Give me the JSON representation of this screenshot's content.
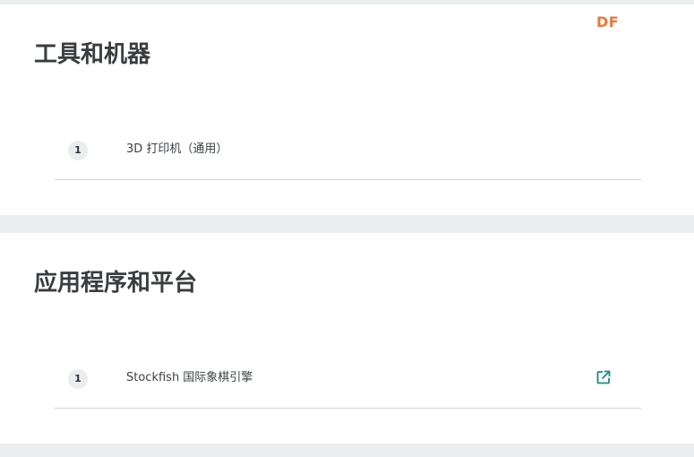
{
  "watermark": "DF",
  "sections": [
    {
      "title": "工具和机器",
      "items": [
        {
          "number": "1",
          "name": "3D 打印机（通用）"
        }
      ]
    },
    {
      "title": "应用程序和平台",
      "items": [
        {
          "number": "1",
          "name": "Stockfish 国际象棋引擎",
          "icon": "external-link-icon"
        }
      ]
    }
  ],
  "colors": {
    "page_background": "#ebeeee",
    "accent_teal": "#1a8a86",
    "watermark_orange": "#e9783d"
  }
}
